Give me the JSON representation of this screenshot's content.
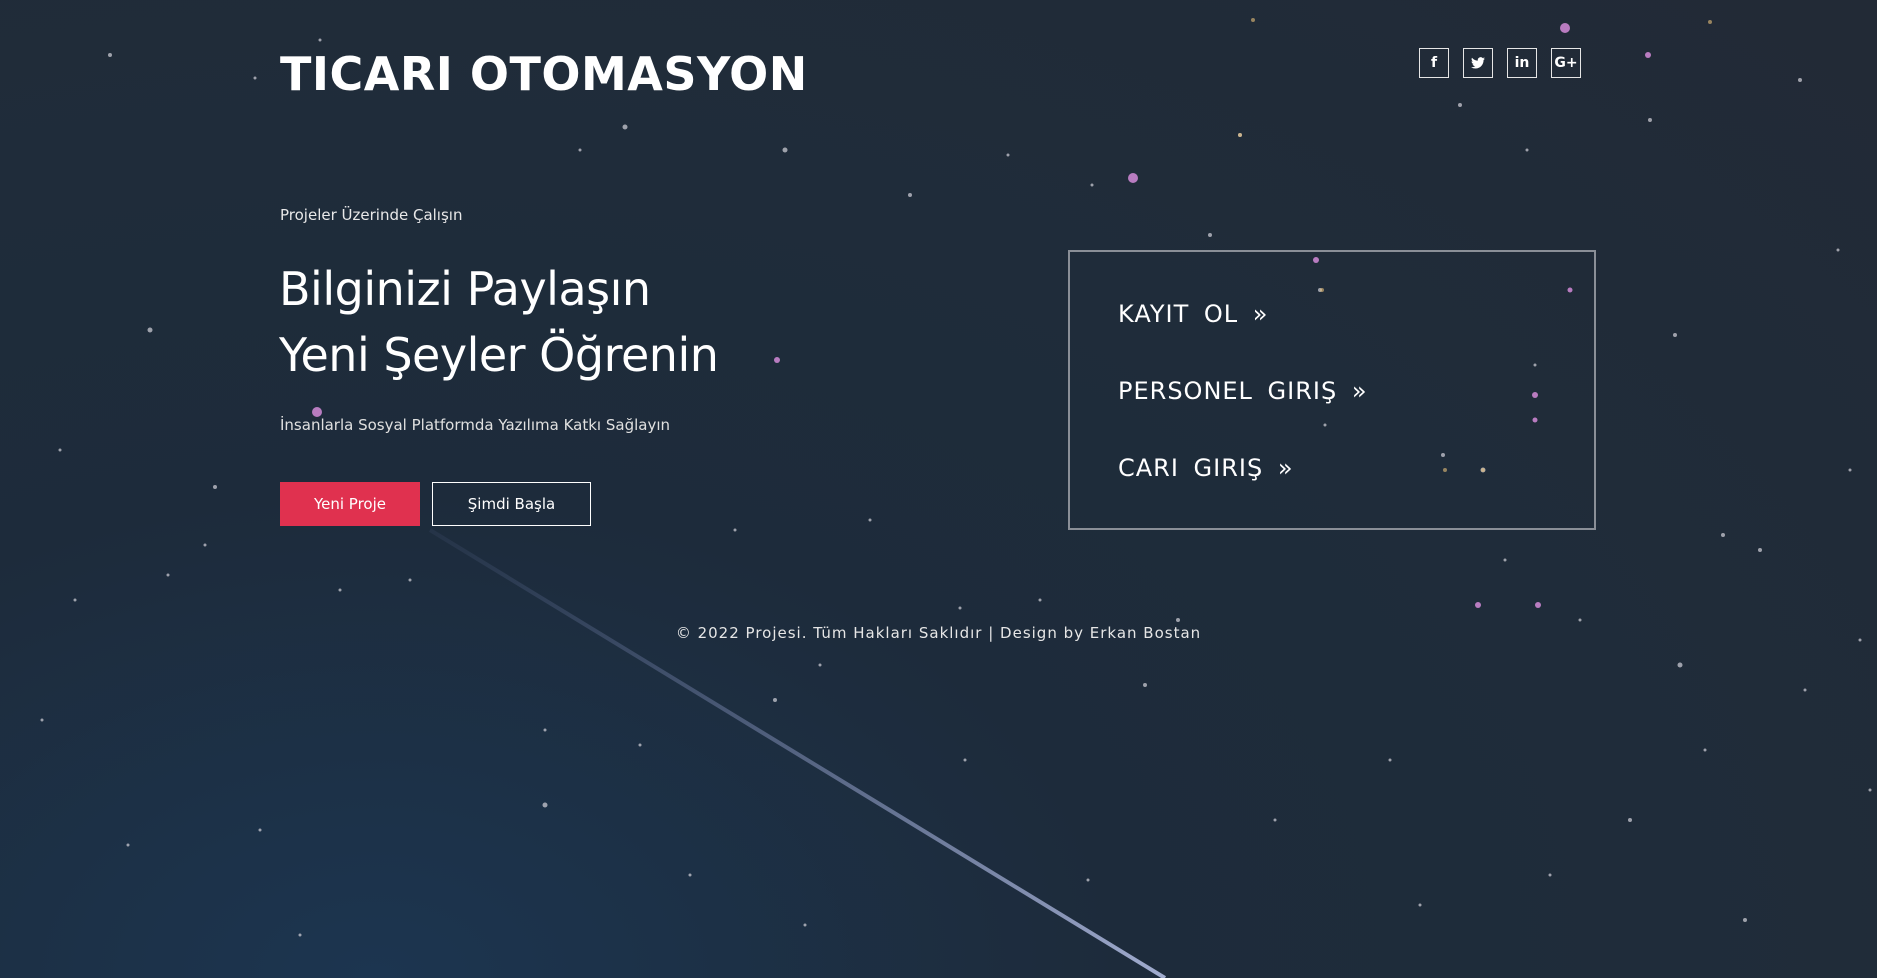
{
  "header": {
    "brand": "TICARI OTOMASYON",
    "social": [
      {
        "icon": "facebook-icon",
        "glyph": "f"
      },
      {
        "icon": "twitter-icon",
        "glyph": "t"
      },
      {
        "icon": "linkedin-icon",
        "glyph": "in"
      },
      {
        "icon": "google-plus-icon",
        "glyph": "G+"
      }
    ]
  },
  "hero": {
    "eyebrow": "Projeler Üzerinde Çalışın",
    "headline_line1": "Bilginizi Paylaşın",
    "headline_line2": "Yeni Şeyler Öğrenin",
    "tagline": "İnsanlarla Sosyal Platformda Yazılıma Katkı Sağlayın",
    "primary_button": "Yeni Proje",
    "secondary_button": "Şimdi Başla"
  },
  "panel": {
    "links": [
      {
        "label": "KAYIT OL »"
      },
      {
        "label": "PERSONEL GIRIŞ »"
      },
      {
        "label": "CARI GIRIŞ »"
      }
    ]
  },
  "footer": {
    "text": "© 2022 Projesi. Tüm Hakları Saklıdır | Design by Erkan Bostan"
  },
  "colors": {
    "background": "#1f2c3a",
    "accent": "#e0314f",
    "panel_border": "#8a8f97"
  }
}
